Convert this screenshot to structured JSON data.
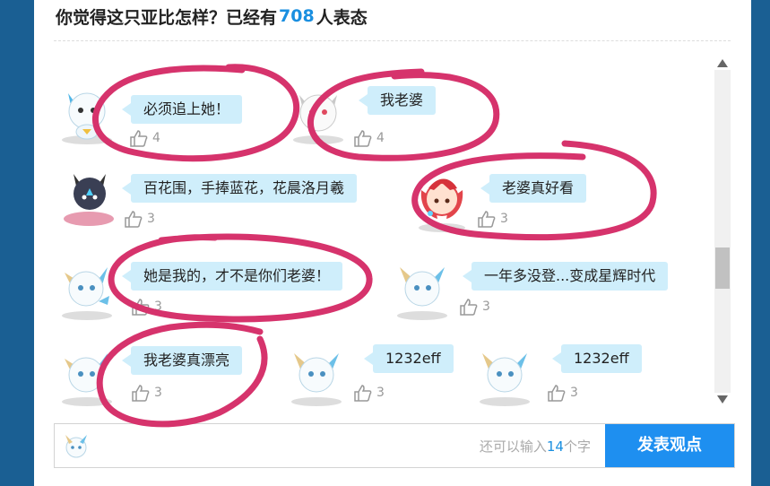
{
  "header": {
    "title_prefix": "你觉得这只亚比怎样？已经有",
    "count": "708",
    "title_suffix": "人表态"
  },
  "comments": [
    {
      "text": "必须追上她！",
      "likes": "4"
    },
    {
      "text": "我老婆",
      "likes": "4"
    },
    {
      "text": "百花围，手捧蓝花，花晨洛月羲",
      "likes": "3"
    },
    {
      "text": "老婆真好看",
      "likes": "3"
    },
    {
      "text": "她是我的，才不是你们老婆！",
      "likes": "3"
    },
    {
      "text": "一年多没登...变成星辉时代",
      "likes": "3"
    },
    {
      "text": "我老婆真漂亮",
      "likes": "3"
    },
    {
      "text": "1232eff",
      "likes": "3"
    },
    {
      "text": "1232eff",
      "likes": "3"
    }
  ],
  "input": {
    "placeholder": "",
    "remain_prefix": "还可以输入",
    "remain_count": "14",
    "remain_suffix": "个字"
  },
  "submit_label": "发表观点",
  "colors": {
    "accent": "#1e8ff0",
    "bubble": "#cfeefb",
    "annotation": "#d6336c"
  }
}
